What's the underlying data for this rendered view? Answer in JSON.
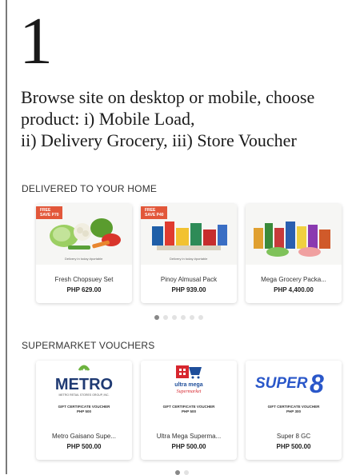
{
  "step": {
    "number": "1",
    "lines": [
      "Browse site on desktop or mobile, choose",
      "product: i) Mobile Load,",
      "ii) Delivery Grocery, iii) Store Voucher"
    ]
  },
  "delivered": {
    "title": "DELIVERED TO YOUR HOME",
    "cards": [
      {
        "name": "Fresh Chopsuey Set",
        "price": "PHP 629.00",
        "badge_top": "FREE",
        "badge": "SAVE P70",
        "caption": "Delivery in today #portable"
      },
      {
        "name": "Pinoy Almusal Pack",
        "price": "PHP 939.00",
        "badge_top": "FREE",
        "badge": "SAVE P40",
        "caption": "Delivery in today #portable"
      },
      {
        "name": "Mega Grocery Packa...",
        "price": "PHP 4,400.00"
      }
    ],
    "dots": {
      "count": 6,
      "active": 0
    }
  },
  "vouchers": {
    "title": "SUPERMARKET VOUCHERS",
    "cards": [
      {
        "logo": "METRO",
        "logo_sub": "METRO RETAIL STORES GROUP, INC.",
        "gc_label": "GIFT CERTIFICATE VOUCHER",
        "gc_value": "PHP 500",
        "name": "Metro Gaisano Supe...",
        "price": "PHP 500.00"
      },
      {
        "logo": "ultra mega",
        "logo_sub": "Supermarket",
        "gc_label": "GIFT CERTIFICATE VOUCHER",
        "gc_value": "PHP 500",
        "name": "Ultra Mega Superma...",
        "price": "PHP 500.00"
      },
      {
        "logo": "SUPER",
        "logo_num": "8",
        "gc_label": "GIFT CERTIFICATE VOUCHER",
        "gc_value": "PHP 300",
        "name": "Super 8 GC",
        "price": "PHP 500.00"
      }
    ],
    "dots": {
      "count": 2,
      "active": 0
    }
  },
  "colors": {
    "badge": "#e2573a",
    "metro_blue": "#1f3a73",
    "metro_green": "#6db33f",
    "ultramega_blue": "#1f4e9a",
    "ultramega_red": "#d7262e",
    "super8_blue": "#2a57c9"
  }
}
